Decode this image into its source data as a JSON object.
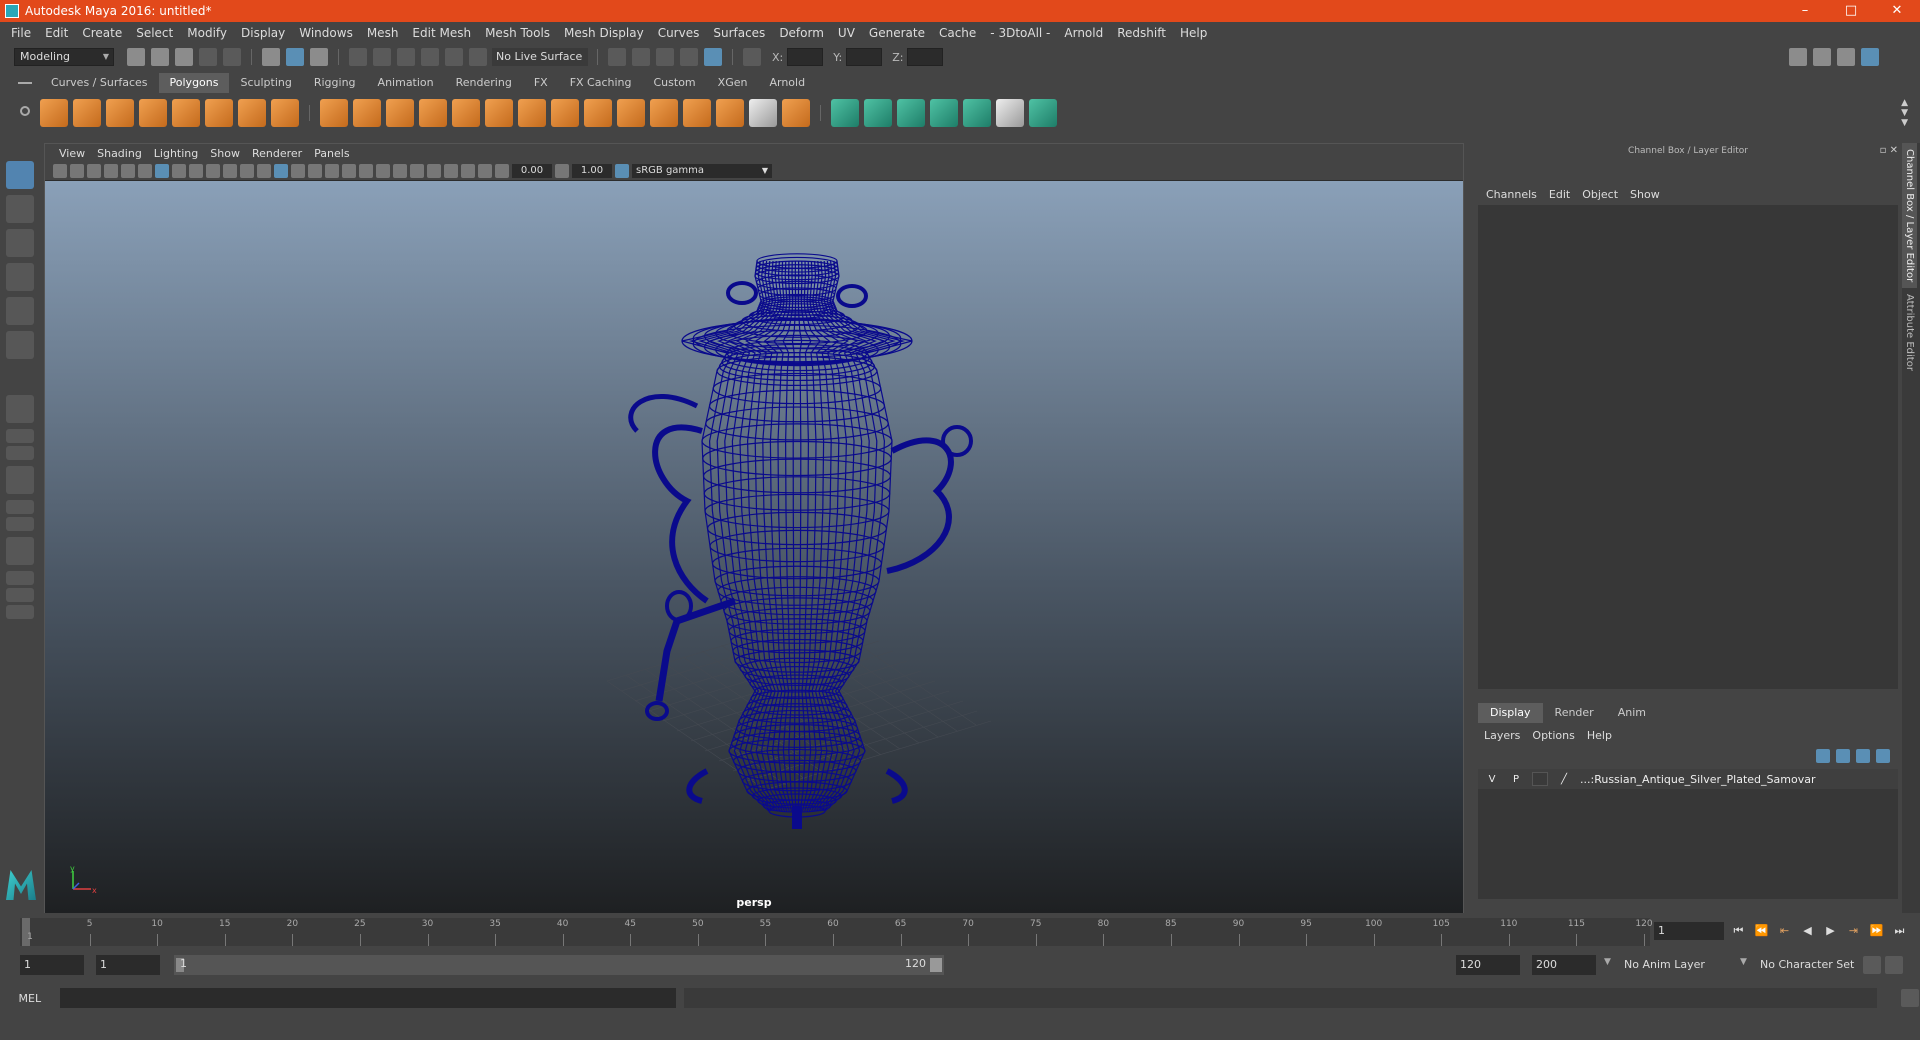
{
  "window": {
    "title": "Autodesk Maya 2016: untitled*",
    "controls": [
      "–",
      "□",
      "✕"
    ]
  },
  "menubar": [
    "File",
    "Edit",
    "Create",
    "Select",
    "Modify",
    "Display",
    "Windows",
    "Mesh",
    "Edit Mesh",
    "Mesh Tools",
    "Mesh Display",
    "Curves",
    "Surfaces",
    "Deform",
    "UV",
    "Generate",
    "Cache",
    "- 3DtoAll -",
    "Arnold",
    "Redshift",
    "Help"
  ],
  "statusline": {
    "mode": "Modeling",
    "live_surface": "No Live Surface",
    "x_label": "X:",
    "y_label": "Y:",
    "z_label": "Z:"
  },
  "shelf": {
    "tabs": [
      "Curves / Surfaces",
      "Polygons",
      "Sculpting",
      "Rigging",
      "Animation",
      "Rendering",
      "FX",
      "FX Caching",
      "Custom",
      "XGen",
      "Arnold"
    ],
    "active_tab": "Polygons"
  },
  "viewport": {
    "menu": [
      "View",
      "Shading",
      "Lighting",
      "Show",
      "Renderer",
      "Panels"
    ],
    "exposure": "0.00",
    "gamma": "1.00",
    "colorspace": "sRGB gamma",
    "camera": "persp",
    "axis_x": "x",
    "axis_y": "y",
    "wire_color": "#0a0a8c"
  },
  "channel_box": {
    "title": "Channel Box / Layer Editor",
    "menu": [
      "Channels",
      "Edit",
      "Object",
      "Show"
    ]
  },
  "layer_editor": {
    "tabs": [
      "Display",
      "Render",
      "Anim"
    ],
    "active_tab": "Display",
    "menu": [
      "Layers",
      "Options",
      "Help"
    ],
    "layers": [
      {
        "v": "V",
        "p": "P",
        "name": "...:Russian_Antique_Silver_Plated_Samovar"
      }
    ]
  },
  "side_tabs": [
    "Channel Box / Layer Editor",
    "Attribute Editor"
  ],
  "timeline": {
    "ticks": [
      "5",
      "10",
      "15",
      "20",
      "25",
      "30",
      "35",
      "40",
      "45",
      "50",
      "55",
      "60",
      "65",
      "70",
      "75",
      "80",
      "85",
      "90",
      "95",
      "100",
      "105",
      "110",
      "115",
      "120"
    ],
    "current_frame": "1",
    "first_frame_label": "1"
  },
  "playback": [
    "⏮",
    "⏪",
    "⇤",
    "◀",
    "▶",
    "⇥",
    "⏩",
    "⏭"
  ],
  "range": {
    "start_field": "1",
    "start_field2": "1",
    "slider_start": "1",
    "slider_end": "120",
    "end_field": "120",
    "end_field2": "200",
    "anim_layer": "No Anim Layer",
    "character_set": "No Character Set"
  },
  "cmdline": {
    "label": "MEL"
  }
}
